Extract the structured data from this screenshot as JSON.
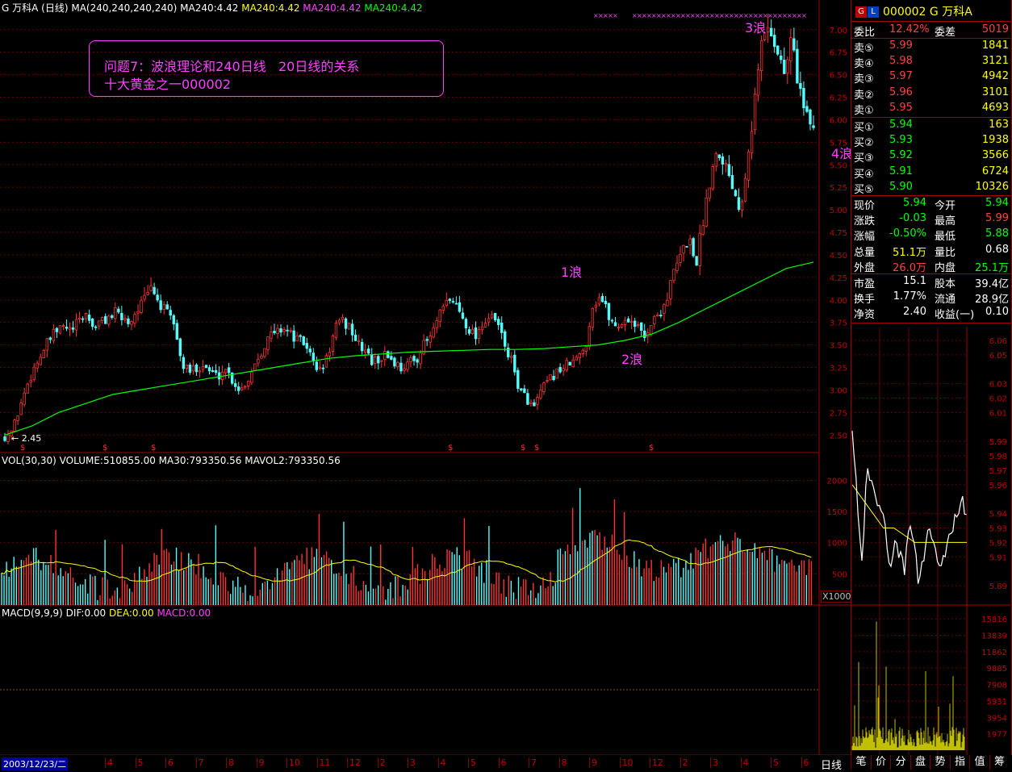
{
  "header": {
    "stock_prefix": "G 万科A (日线)",
    "ma_spec": "MA(240,240,240,240)",
    "ma_vals": [
      "MA240:4.42",
      "MA240:4.42",
      "MA240:4.42",
      "MA240:4.42"
    ],
    "ma_colors": [
      "#ffffff",
      "#ffff00",
      "#ff00ff",
      "#00ff00"
    ]
  },
  "annotation": {
    "line1": "问题7：波浪理论和240日线   20日线的关系",
    "line2": "十大黄金之一000002"
  },
  "wave_labels": [
    {
      "text": "1浪",
      "x": 695,
      "y": 340
    },
    {
      "text": "2浪",
      "x": 770,
      "y": 448
    },
    {
      "text": "3浪",
      "x": 923,
      "y": 36
    },
    {
      "text": "4浪",
      "x": 1032,
      "y": 192
    }
  ],
  "low_marker": "← 2.45",
  "vol_header": "VOL(30,30) VOLUME:510855.00 MA30:793350.56 MAVOL2:793350.56",
  "vol_unit": "X1000",
  "macd_header": {
    "label": "MACD(9,9,9) DIF:0.00",
    "dea": "DEA:0.00",
    "macd": "MACD:0.00"
  },
  "bottom": {
    "date": "2003/12/23/二",
    "months": [
      "4",
      "5",
      "6",
      "7",
      "8",
      "9",
      "10",
      "11",
      "12",
      "2",
      "3",
      "4",
      "5",
      "6",
      "7",
      "8",
      "9",
      "10",
      "12",
      "2",
      "3",
      "4",
      "5",
      "6"
    ],
    "period_tab": "日线"
  },
  "side": {
    "code_name": "000002 G 万科A",
    "weibi": {
      "label": "委比",
      "pct": "12.42%",
      "diff_label": "委差",
      "diff": "5019"
    },
    "asks": [
      {
        "label": "卖⑤",
        "price": "5.99",
        "vol": "1841"
      },
      {
        "label": "卖④",
        "price": "5.98",
        "vol": "3121"
      },
      {
        "label": "卖③",
        "price": "5.97",
        "vol": "4942"
      },
      {
        "label": "卖②",
        "price": "5.96",
        "vol": "3101"
      },
      {
        "label": "卖①",
        "price": "5.95",
        "vol": "4693"
      }
    ],
    "bids": [
      {
        "label": "买①",
        "price": "5.94",
        "vol": "163"
      },
      {
        "label": "买②",
        "price": "5.93",
        "vol": "1938"
      },
      {
        "label": "买③",
        "price": "5.92",
        "vol": "3566"
      },
      {
        "label": "买④",
        "price": "5.91",
        "vol": "6724"
      },
      {
        "label": "买⑤",
        "price": "5.90",
        "vol": "10326"
      }
    ],
    "quote": [
      {
        "l1": "现价",
        "v1": "5.94",
        "c1": "#00ff00",
        "l2": "今开",
        "v2": "5.94",
        "c2": "#00ff00"
      },
      {
        "l1": "涨跌",
        "v1": "-0.03",
        "c1": "#00ff00",
        "l2": "最高",
        "v2": "5.99",
        "c2": "#ff4040"
      },
      {
        "l1": "涨幅",
        "v1": "-0.50%",
        "c1": "#00ff00",
        "l2": "最低",
        "v2": "5.88",
        "c2": "#00ff00"
      },
      {
        "l1": "总量",
        "v1": "51.1万",
        "c1": "#ffff00",
        "l2": "量比",
        "v2": "0.68",
        "c2": "#ffffff"
      },
      {
        "l1": "外盘",
        "v1": "26.0万",
        "c1": "#ff4040",
        "l2": "内盘",
        "v2": "25.1万",
        "c2": "#00ff00"
      }
    ],
    "fund": [
      {
        "l1": "市盈",
        "v1": "15.1",
        "l2": "股本",
        "v2": "39.4亿"
      },
      {
        "l1": "换手",
        "v1": "1.77%",
        "l2": "流通",
        "v2": "28.9亿"
      },
      {
        "l1": "净资",
        "v1": "2.40",
        "l2": "收益(一)",
        "v2": "0.10"
      }
    ],
    "tabs": [
      "笔",
      "价",
      "分",
      "盘",
      "势",
      "指",
      "值",
      "筹"
    ]
  },
  "chart_data": [
    {
      "type": "candlestick",
      "ylim": [
        2.35,
        7.15
      ],
      "y_ticks": [
        "7.00",
        "6.75",
        "6.50",
        "6.25",
        "6.00",
        "5.75",
        "5.50",
        "5.25",
        "5.00",
        "4.75",
        "4.50",
        "4.25",
        "4.00",
        "3.75",
        "3.50",
        "3.25",
        "3.00",
        "2.75",
        "2.50"
      ],
      "close_path": [
        2.48,
        2.55,
        2.8,
        3.05,
        3.25,
        3.4,
        3.55,
        3.65,
        3.7,
        3.65,
        3.75,
        3.85,
        3.7,
        3.75,
        3.8,
        3.85,
        3.8,
        3.75,
        3.9,
        4.0,
        4.15,
        3.95,
        3.85,
        3.75,
        3.3,
        3.2,
        3.25,
        3.28,
        3.2,
        3.15,
        3.25,
        3.1,
        3.0,
        3.1,
        3.3,
        3.45,
        3.6,
        3.65,
        3.7,
        3.6,
        3.55,
        3.5,
        3.3,
        3.2,
        3.4,
        3.7,
        3.75,
        3.7,
        3.5,
        3.45,
        3.3,
        3.35,
        3.4,
        3.3,
        3.25,
        3.3,
        3.35,
        3.5,
        3.6,
        3.8,
        3.95,
        4.0,
        3.85,
        3.7,
        3.6,
        3.75,
        3.8,
        3.75,
        3.5,
        3.3,
        3.0,
        2.9,
        2.8,
        3.0,
        3.1,
        3.2,
        3.25,
        3.3,
        3.35,
        3.5,
        3.95,
        4.05,
        3.85,
        3.7,
        3.75,
        3.8,
        3.7,
        3.6,
        3.75,
        3.85,
        4.0,
        4.3,
        4.5,
        4.7,
        4.4,
        4.9,
        5.4,
        5.7,
        5.5,
        5.3,
        5.0,
        5.6,
        6.2,
        6.9,
        7.05,
        6.8,
        6.5,
        6.9,
        6.4,
        6.0,
        5.94
      ],
      "ma240_path": [
        2.5,
        2.6,
        2.75,
        2.85,
        2.95,
        3.0,
        3.05,
        3.1,
        3.15,
        3.2,
        3.25,
        3.3,
        3.35,
        3.38,
        3.4,
        3.42,
        3.43,
        3.44,
        3.45,
        3.45,
        3.46,
        3.48,
        3.5,
        3.55,
        3.62,
        3.75,
        3.9,
        4.05,
        4.2,
        4.35,
        4.42
      ],
      "wave_points": {
        "1浪": 4.08,
        "2浪": 3.55,
        "3浪": 7.05,
        "4浪": 5.8
      },
      "low_label": 2.45
    },
    {
      "type": "bar",
      "title": "VOL(30,30)",
      "y_ticks": [
        "2000",
        "1500",
        "1000",
        "500"
      ],
      "unit": "X1000",
      "volume": 510855.0,
      "ma30": 793350.56
    },
    {
      "type": "line",
      "title": "MACD(9,9,9)",
      "dif": 0.0,
      "dea": 0.0,
      "macd": 0.0
    },
    {
      "type": "line",
      "title": "intraday",
      "y_ticks": [
        "6.06",
        "6.05",
        "6.03",
        "6.02",
        "6.01",
        "5.99",
        "5.98",
        "5.97",
        "5.96",
        "5.94",
        "5.93",
        "5.92",
        "5.91",
        "5.89"
      ],
      "price_path": [
        6.0,
        5.95,
        5.9,
        5.97,
        5.96,
        5.95,
        5.94,
        5.93,
        5.9,
        5.92,
        5.91,
        5.9,
        5.93,
        5.92,
        5.89,
        5.91,
        5.93,
        5.92,
        5.9,
        5.91,
        5.92,
        5.93,
        5.94,
        5.95,
        5.94
      ],
      "avg_path": [
        5.96,
        5.95,
        5.94,
        5.93,
        5.93,
        5.925,
        5.92,
        5.92,
        5.92,
        5.92,
        5.92,
        5.92
      ]
    },
    {
      "type": "bar",
      "title": "intraday volume",
      "y_ticks": [
        "15816",
        "13839",
        "11862",
        "9885",
        "7908",
        "5931",
        "3954",
        "1977"
      ]
    }
  ]
}
